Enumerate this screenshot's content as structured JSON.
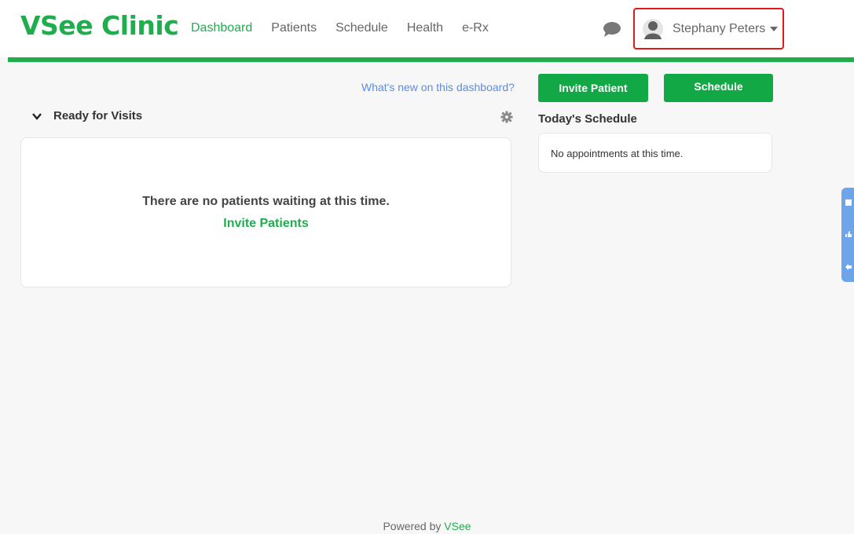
{
  "app": {
    "logo": "VSee Clinic"
  },
  "nav": [
    {
      "label": "Dashboard",
      "active": true
    },
    {
      "label": "Patients"
    },
    {
      "label": "Schedule"
    },
    {
      "label": "Health"
    },
    {
      "label": "e-Rx"
    }
  ],
  "header": {
    "icons": {
      "chat": "chat-bubble-icon",
      "avatar": "user-avatar-icon",
      "caret": "caret-down-icon"
    },
    "user_name": "Stephany Peters"
  },
  "toolbar": {
    "whats_new": "What's new on this dashboard?",
    "invite_patient": "Invite Patient",
    "schedule": "Schedule"
  },
  "ready": {
    "title": "Ready for Visits",
    "empty_message": "There are no patients waiting at this time.",
    "invite_link": "Invite Patients"
  },
  "today": {
    "title": "Today's Schedule",
    "empty_message": "No appointments at this time."
  },
  "footer": {
    "prefix": "Powered by",
    "brand": "VSee"
  },
  "colors": {
    "brand_green": "#1fad4e",
    "button_green": "#11a845",
    "link_blue": "#5b8de0",
    "highlight_red": "#e01919"
  }
}
